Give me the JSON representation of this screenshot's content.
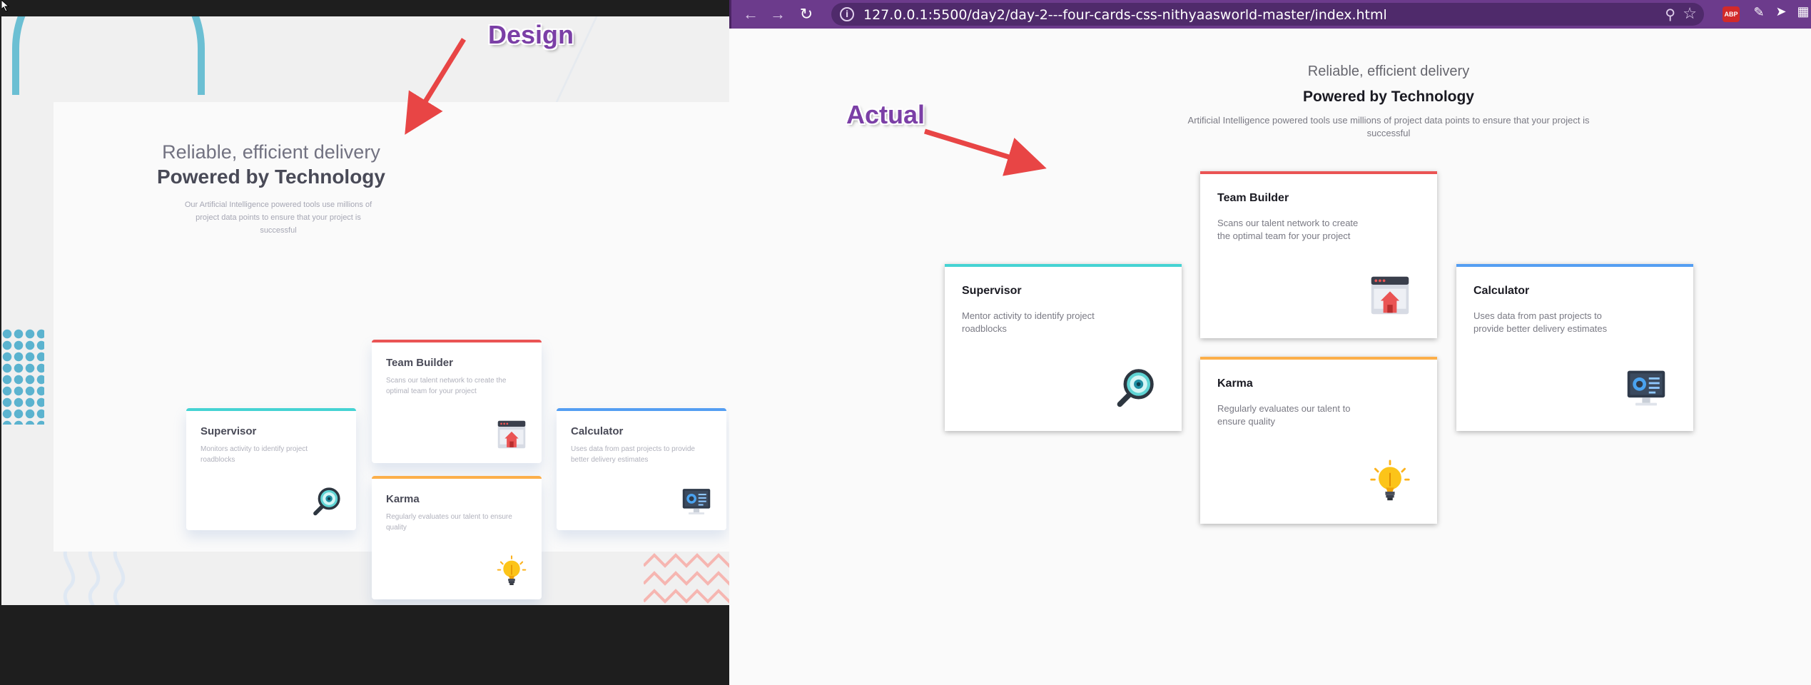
{
  "annotations": {
    "design_label": "Design",
    "actual_label": "Actual",
    "arrow_color": "#e84545",
    "label_color": "#7b3fa6"
  },
  "browser": {
    "url": "127.0.0.1:5500/day2/day-2---four-cards-css-nithyaasworld-master/index.html",
    "nav_icons": [
      "back-arrow-icon",
      "forward-arrow-icon",
      "reload-icon"
    ],
    "url_icons": [
      "info-icon",
      "zoom-icon",
      "star-icon"
    ],
    "extensions": [
      {
        "name": "adblock-plus",
        "label": "ABP"
      },
      {
        "name": "pen-extension"
      },
      {
        "name": "cursor-extension"
      },
      {
        "name": "more-extension"
      }
    ],
    "toolbar_color": "#6c3b8c"
  },
  "design": {
    "subtitle": "Reliable, efficient delivery",
    "title": "Powered by Technology",
    "description": "Our Artificial Intelligence powered tools use millions of project data points to ensure that your project is successful",
    "cards": {
      "supervisor": {
        "title": "Supervisor",
        "desc": "Monitors activity to identify project roadblocks",
        "icon": "magnifier-icon",
        "accent": "#45d3d3"
      },
      "team_builder": {
        "title": "Team Builder",
        "desc": "Scans our talent network to create the optimal team for your project",
        "icon": "team-builder-icon",
        "accent": "#ea5454"
      },
      "karma": {
        "title": "Karma",
        "desc": "Regularly evaluates our talent to ensure quality",
        "icon": "lightbulb-icon",
        "accent": "#fcaf4a"
      },
      "calculator": {
        "title": "Calculator",
        "desc": "Uses data from past projects to provide better delivery estimates",
        "icon": "calculator-monitor-icon",
        "accent": "#549ef2"
      }
    }
  },
  "actual": {
    "subtitle": "Reliable, efficient delivery",
    "title": "Powered by Technology",
    "description": "Artificial Intelligence powered tools use millions of project data points to ensure that your project is successful",
    "cards": {
      "supervisor": {
        "title": "Supervisor",
        "desc": "Mentor activity to identify project roadblocks"
      },
      "team_builder": {
        "title": "Team Builder",
        "desc": "Scans our talent network to create the optimal team for your project"
      },
      "karma": {
        "title": "Karma",
        "desc": "Regularly evaluates our talent to ensure quality"
      },
      "calculator": {
        "title": "Calculator",
        "desc": "Uses data from past projects to provide better delivery estimates"
      }
    }
  }
}
